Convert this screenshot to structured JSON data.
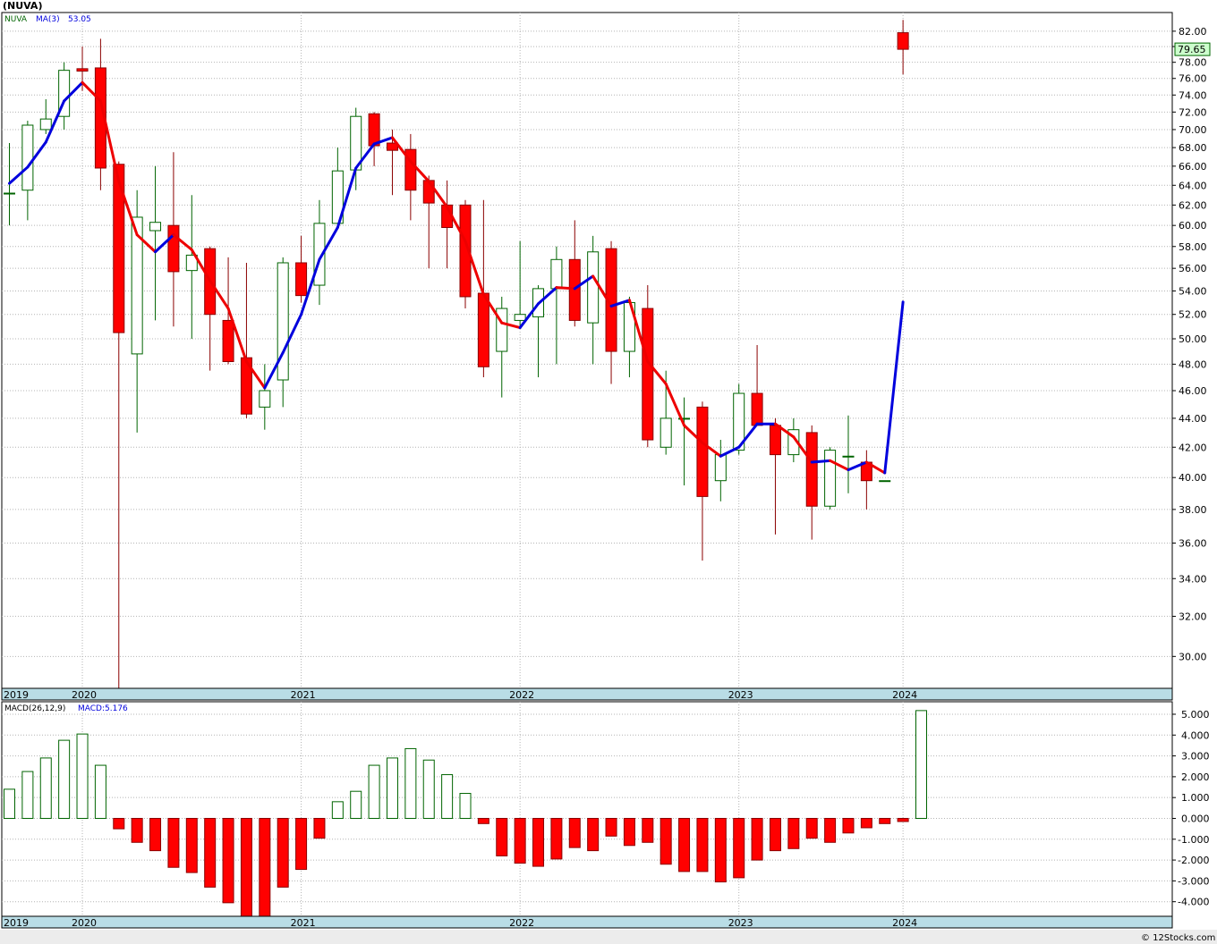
{
  "title": "(NUVA)",
  "credit": "© 12Stocks.com",
  "colors": {
    "up_fill": "#ffffff",
    "up_stroke": "#006400",
    "down_fill": "#ff0000",
    "down_stroke": "#8b0000",
    "ma_up": "#0000dd",
    "ma_down": "#ee0000",
    "grid": "#b4b4b4",
    "axis_band": "#b9dde6",
    "last_price_bg": "#ccffcc",
    "last_price_border": "#006400"
  },
  "price_panel": {
    "legend": [
      {
        "text": "NUVA",
        "color": "#006400"
      },
      {
        "text": "MA(3)",
        "color": "#0000dd"
      },
      {
        "text": "53.05",
        "color": "#0000dd"
      }
    ],
    "last_price_label": "79.65",
    "y_ticks": [
      "82.00",
      "80.00",
      "78.00",
      "76.00",
      "74.00",
      "72.00",
      "70.00",
      "68.00",
      "66.00",
      "64.00",
      "62.00",
      "60.00",
      "58.00",
      "56.00",
      "54.00",
      "52.00",
      "50.00",
      "48.00",
      "46.00",
      "44.00",
      "42.00",
      "40.00",
      "38.00",
      "36.00",
      "34.00",
      "32.00",
      "30.00"
    ],
    "year_labels": [
      "2019",
      "2020",
      "2021",
      "2022",
      "2023",
      "2024"
    ]
  },
  "macd_panel": {
    "legend": [
      {
        "text": "MACD(26,12,9)",
        "color": "#000000"
      },
      {
        "text": "MACD:5.176",
        "color": "#0000dd"
      }
    ],
    "y_ticks": [
      "5.000",
      "4.000",
      "3.000",
      "2.000",
      "1.000",
      "0.000",
      "-1.000",
      "-2.000",
      "-3.000",
      "-4.000"
    ],
    "year_labels": [
      "2019",
      "2020",
      "2021",
      "2022",
      "2023",
      "2024"
    ]
  },
  "chart_data": [
    {
      "type": "candlestick",
      "series_name": "NUVA",
      "scale": "log",
      "ylim": [
        28.5,
        84.5
      ],
      "x_years": [
        "2019",
        "2020",
        "2021",
        "2022",
        "2023",
        "2024"
      ],
      "candles": [
        {
          "o": 63.2,
          "h": 68.5,
          "l": 60.0,
          "c": 63.2
        },
        {
          "o": 63.5,
          "h": 71.0,
          "l": 60.5,
          "c": 70.5
        },
        {
          "o": 70.0,
          "h": 73.5,
          "l": 69.5,
          "c": 71.2
        },
        {
          "o": 71.5,
          "h": 78.0,
          "l": 70.0,
          "c": 77.0
        },
        {
          "o": 77.2,
          "h": 80.0,
          "l": 74.5,
          "c": 76.9
        },
        {
          "o": 77.3,
          "h": 81.0,
          "l": 63.5,
          "c": 65.8
        },
        {
          "o": 66.2,
          "h": 66.5,
          "l": 28.5,
          "c": 50.5
        },
        {
          "o": 48.8,
          "h": 63.5,
          "l": 43.0,
          "c": 60.8
        },
        {
          "o": 59.5,
          "h": 66.0,
          "l": 51.5,
          "c": 60.3
        },
        {
          "o": 60.0,
          "h": 67.5,
          "l": 51.0,
          "c": 55.7
        },
        {
          "o": 55.8,
          "h": 63.0,
          "l": 50.0,
          "c": 57.2
        },
        {
          "o": 57.8,
          "h": 58.0,
          "l": 47.5,
          "c": 52.0
        },
        {
          "o": 51.5,
          "h": 57.0,
          "l": 48.0,
          "c": 48.2
        },
        {
          "o": 48.5,
          "h": 56.5,
          "l": 44.0,
          "c": 44.3
        },
        {
          "o": 44.8,
          "h": 48.0,
          "l": 43.2,
          "c": 46.0
        },
        {
          "o": 46.8,
          "h": 57.0,
          "l": 44.8,
          "c": 56.5
        },
        {
          "o": 56.5,
          "h": 59.0,
          "l": 53.0,
          "c": 53.6
        },
        {
          "o": 54.5,
          "h": 62.5,
          "l": 52.8,
          "c": 60.2
        },
        {
          "o": 60.2,
          "h": 68.0,
          "l": 60.0,
          "c": 65.5
        },
        {
          "o": 65.6,
          "h": 72.5,
          "l": 63.5,
          "c": 71.5
        },
        {
          "o": 71.8,
          "h": 72.0,
          "l": 66.0,
          "c": 68.2
        },
        {
          "o": 68.5,
          "h": 70.0,
          "l": 63.0,
          "c": 67.7
        },
        {
          "o": 67.8,
          "h": 69.5,
          "l": 60.5,
          "c": 63.5
        },
        {
          "o": 64.5,
          "h": 65.0,
          "l": 56.0,
          "c": 62.2
        },
        {
          "o": 62.0,
          "h": 64.5,
          "l": 56.0,
          "c": 59.8
        },
        {
          "o": 62.0,
          "h": 62.5,
          "l": 52.5,
          "c": 53.5
        },
        {
          "o": 53.8,
          "h": 62.5,
          "l": 47.0,
          "c": 47.8
        },
        {
          "o": 49.0,
          "h": 53.5,
          "l": 45.5,
          "c": 52.5
        },
        {
          "o": 51.5,
          "h": 58.5,
          "l": 51.0,
          "c": 52.0
        },
        {
          "o": 51.8,
          "h": 54.5,
          "l": 47.0,
          "c": 54.2
        },
        {
          "o": 54.2,
          "h": 58.0,
          "l": 48.0,
          "c": 56.8
        },
        {
          "o": 56.8,
          "h": 60.5,
          "l": 51.0,
          "c": 51.5
        },
        {
          "o": 51.3,
          "h": 59.0,
          "l": 48.0,
          "c": 57.5
        },
        {
          "o": 57.8,
          "h": 58.5,
          "l": 46.5,
          "c": 49.0
        },
        {
          "o": 49.0,
          "h": 53.5,
          "l": 47.0,
          "c": 53.0
        },
        {
          "o": 52.5,
          "h": 54.5,
          "l": 42.0,
          "c": 42.5
        },
        {
          "o": 42.0,
          "h": 47.5,
          "l": 41.5,
          "c": 44.0
        },
        {
          "o": 44.0,
          "h": 45.5,
          "l": 39.5,
          "c": 44.0
        },
        {
          "o": 44.8,
          "h": 45.2,
          "l": 35.0,
          "c": 38.8
        },
        {
          "o": 39.8,
          "h": 42.5,
          "l": 38.5,
          "c": 41.5
        },
        {
          "o": 41.8,
          "h": 46.5,
          "l": 41.5,
          "c": 45.8
        },
        {
          "o": 45.8,
          "h": 49.5,
          "l": 43.5,
          "c": 43.5
        },
        {
          "o": 43.5,
          "h": 44.0,
          "l": 36.5,
          "c": 41.5
        },
        {
          "o": 41.5,
          "h": 44.0,
          "l": 41.0,
          "c": 43.2
        },
        {
          "o": 43.0,
          "h": 43.5,
          "l": 36.2,
          "c": 38.2
        },
        {
          "o": 38.2,
          "h": 42.0,
          "l": 38.0,
          "c": 41.8
        },
        {
          "o": 41.4,
          "h": 44.2,
          "l": 39.0,
          "c": 41.4
        },
        {
          "o": 41.0,
          "h": 41.8,
          "l": 38.0,
          "c": 39.8
        },
        {
          "o": 39.8,
          "h": 39.8,
          "l": 39.8,
          "c": 39.8
        },
        {
          "o": 81.8,
          "h": 83.5,
          "l": 76.5,
          "c": 79.65
        }
      ],
      "ma3": [
        64.2,
        65.9,
        68.6,
        73.3,
        75.5,
        73.3,
        64.4,
        59.1,
        57.5,
        59.1,
        57.7,
        54.9,
        52.5,
        48.2,
        46.2,
        48.9,
        52.0,
        56.8,
        59.8,
        65.8,
        68.4,
        69.1,
        66.5,
        64.4,
        61.8,
        58.5,
        53.7,
        51.3,
        50.9,
        52.9,
        54.3,
        54.2,
        55.3,
        52.7,
        53.2,
        48.2,
        46.5,
        43.5,
        42.3,
        41.4,
        42.0,
        43.6,
        43.6,
        42.7,
        41.0,
        41.1,
        40.5,
        41.0,
        40.3,
        53.05
      ]
    },
    {
      "type": "bar",
      "series_name": "MACD(26,12,9)",
      "ylim": [
        -4.7,
        5.6
      ],
      "x_years": [
        "2019",
        "2020",
        "2021",
        "2022",
        "2023",
        "2024"
      ],
      "values": [
        1.4,
        2.25,
        2.9,
        3.75,
        4.05,
        2.55,
        -0.5,
        -1.15,
        -1.55,
        -2.35,
        -2.6,
        -3.3,
        -4.05,
        -4.8,
        -4.8,
        -3.3,
        -2.45,
        -0.95,
        0.8,
        1.3,
        2.55,
        2.9,
        3.35,
        2.8,
        2.1,
        1.2,
        -0.25,
        -1.8,
        -2.15,
        -2.3,
        -1.95,
        -1.4,
        -1.55,
        -0.85,
        -1.3,
        -1.15,
        -2.2,
        -2.55,
        -2.55,
        -3.05,
        -2.85,
        -2.0,
        -1.55,
        -1.45,
        -0.95,
        -1.15,
        -0.7,
        -0.45,
        -0.25,
        -0.15,
        5.176
      ]
    }
  ]
}
